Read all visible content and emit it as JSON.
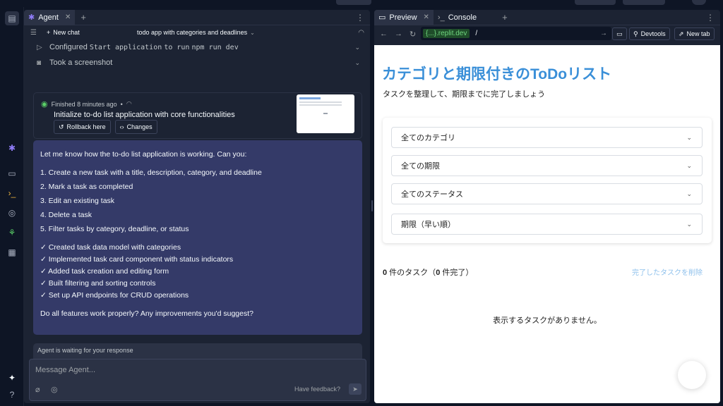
{
  "agent_panel": {
    "tab_label": "Agent",
    "new_chat_label": "New chat",
    "chat_title": "todo app with categories and deadlines",
    "steps": [
      {
        "prefix": "Configured",
        "code": "Start application",
        "suffix": "to run",
        "code2": "npm run dev"
      },
      {
        "text": "Took a screenshot"
      }
    ],
    "checkpoint": {
      "status": "Finished 8 minutes ago",
      "title": "Initialize to-do list application with core functionalities",
      "rollback_label": "Rollback here",
      "changes_label": "Changes"
    },
    "message": {
      "intro": "Let me know how the to-do list application is working. Can you:",
      "items": [
        "1. Create a new task with a title, description, category, and deadline",
        "2. Mark a task as completed",
        "3. Edit an existing task",
        "4. Delete a task",
        "5. Filter tasks by category, deadline, or status"
      ],
      "checks": [
        "✓ Created task data model with categories",
        "✓ Implemented task card component with status indicators",
        "✓ Added task creation and editing form",
        "✓ Built filtering and sorting controls",
        "✓ Set up API endpoints for CRUD operations"
      ],
      "question": "Do all features work properly? Any improvements you'd suggest?"
    },
    "waiting_text": "Agent is waiting for your response",
    "composer": {
      "placeholder": "Message Agent...",
      "feedback_label": "Have feedback?"
    }
  },
  "preview_panel": {
    "tabs": [
      {
        "label": "Preview"
      },
      {
        "label": "Console"
      }
    ],
    "url_domain": "{...}.replit.dev",
    "url_path": "/",
    "devtools_label": "Devtools",
    "new_tab_label": "New tab",
    "app": {
      "title": "カテゴリと期限付きのToDoリスト",
      "subtitle": "タスクを整理して、期限までに完了しましょう",
      "filters": [
        "全てのカテゴリ",
        "全ての期限",
        "全てのステータス",
        "期限（早い順）"
      ],
      "count_num": "0",
      "count_mid": " 件のタスク（",
      "done_num": "0",
      "count_end": " 件完了）",
      "clear_label": "完了したタスクを削除",
      "empty_text": "表示するタスクがありません。"
    }
  },
  "colors": {
    "bg": "#0e1525",
    "panel": "#1c2333",
    "message_bg": "#343a68",
    "app_title": "#3a8fd8",
    "domain_badge": "#6fd47e"
  }
}
